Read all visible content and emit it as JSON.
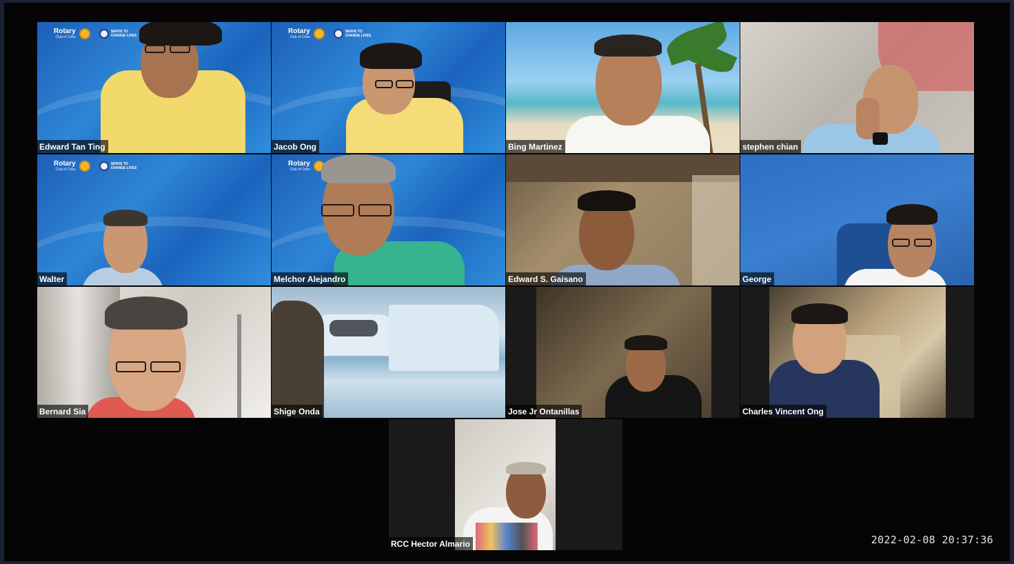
{
  "meeting": {
    "timestamp": "2022-02-08  20:37:36",
    "participants": [
      {
        "name": "Edward Tan Ting"
      },
      {
        "name": "Jacob Ong"
      },
      {
        "name": "Bing Martinez"
      },
      {
        "name": "stephen chian"
      },
      {
        "name": "Walter"
      },
      {
        "name": "Melchor Alejandro"
      },
      {
        "name": "Edward S. Gaisano"
      },
      {
        "name": "George"
      },
      {
        "name": "Bernard Sia"
      },
      {
        "name": "Shige Onda"
      },
      {
        "name": "Jose Jr Ontanillas"
      },
      {
        "name": "Charles Vincent Ong"
      },
      {
        "name": "RCC Hector Almario"
      }
    ]
  },
  "rotary_background": {
    "brand": "Rotary",
    "sub": "Club of Cebu",
    "serve_line1": "SERVE TO",
    "serve_line2": "CHANGE LIVES"
  },
  "colors": {
    "rotary_blue": "#2e86d6",
    "shirt_yellow": "#f2d96b",
    "shirt_teal": "#37b38f",
    "window_border": "#1b2233"
  }
}
